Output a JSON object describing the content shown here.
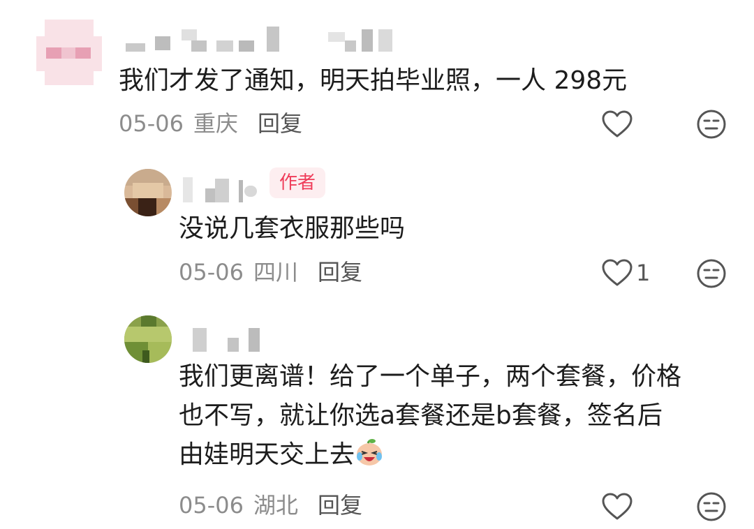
{
  "comments": [
    {
      "text": "我们才发了通知，明天拍毕业照，一人 298元",
      "date": "05-06",
      "location": "重庆",
      "reply_label": "回复",
      "like_count": "",
      "is_author": false
    },
    {
      "text": "没说几套衣服那些吗",
      "date": "05-06",
      "location": "四川",
      "reply_label": "回复",
      "like_count": "1",
      "is_author": true,
      "author_badge": "作者"
    },
    {
      "text_lines": [
        "我们更离谱！给了一个单子，两个套餐，价格",
        "也不写，就让你选a套餐还是b套餐，签名后",
        "由娃明天交上去"
      ],
      "date": "05-06",
      "location": "湖北",
      "reply_label": "回复",
      "like_count": "",
      "is_author": false
    }
  ],
  "icons": {
    "like": "heart-outline-icon",
    "dislike": "unamused-face-icon",
    "emoji": "crying-laughing-emoji"
  },
  "colors": {
    "author_badge_text": "#ef3d5a",
    "author_badge_bg": "#fdeef0",
    "meta_text": "#8c8c8c",
    "icon_stroke": "#555555"
  }
}
